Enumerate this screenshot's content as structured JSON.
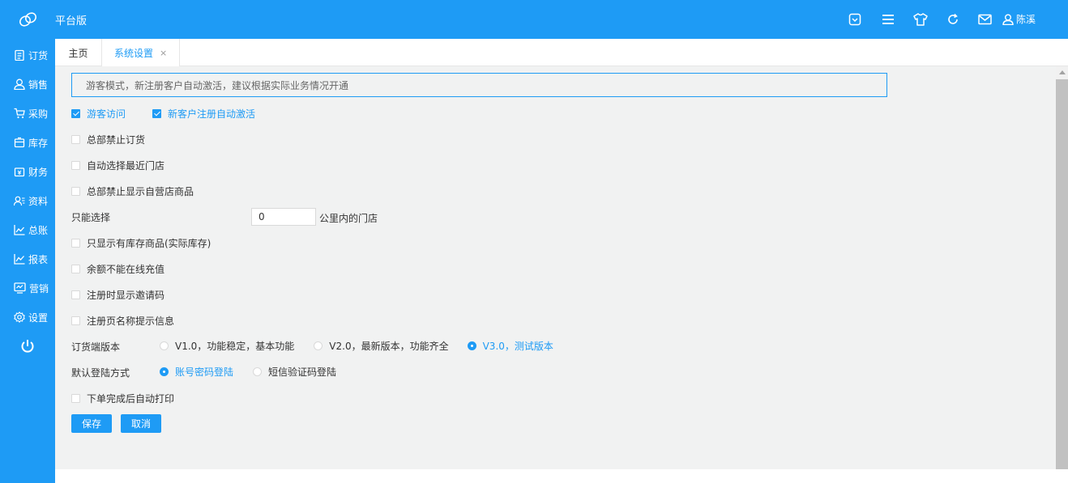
{
  "app": {
    "title": "平台版",
    "user_name": "陈溪"
  },
  "colors": {
    "primary": "#1e9bf5",
    "content_bg": "#f1f2f2"
  },
  "header_icons": [
    "message-icon",
    "menu-icon",
    "shirt-icon",
    "refresh-icon",
    "mail-icon",
    "user-icon"
  ],
  "sidebar": {
    "items": [
      {
        "label": "订货",
        "icon": "order-icon"
      },
      {
        "label": "销售",
        "icon": "sales-icon"
      },
      {
        "label": "采购",
        "icon": "cart-icon"
      },
      {
        "label": "库存",
        "icon": "inventory-icon"
      },
      {
        "label": "财务",
        "icon": "finance-icon"
      },
      {
        "label": "资料",
        "icon": "profile-icon"
      },
      {
        "label": "总账",
        "icon": "ledger-icon"
      },
      {
        "label": "报表",
        "icon": "report-icon"
      },
      {
        "label": "营销",
        "icon": "marketing-icon"
      },
      {
        "label": "设置",
        "icon": "settings-icon"
      }
    ]
  },
  "tabs": {
    "home": "主页",
    "settings": "系统设置",
    "close": "×"
  },
  "notice": "游客模式，新注册客户自动激活，建议根据实际业务情况开通",
  "options": {
    "guest_access": {
      "label": "游客访问",
      "checked": true
    },
    "auto_activate": {
      "label": "新客户注册自动激活",
      "checked": true
    },
    "hq_disable_order": {
      "label": "总部禁止订货",
      "checked": false
    },
    "auto_nearest_store": {
      "label": "自动选择最近门店",
      "checked": false
    },
    "hq_hide_own_products": {
      "label": "总部禁止显示自营店商品",
      "checked": false
    },
    "show_in_stock_only": {
      "label": "只显示有库存商品(实际库存)",
      "checked": false
    },
    "balance_no_online_recharge": {
      "label": "余额不能在线充值",
      "checked": false
    },
    "show_invite_code": {
      "label": "注册时显示邀请码",
      "checked": false
    },
    "register_name_hint": {
      "label": "注册页名称提示信息",
      "checked": false
    },
    "auto_print": {
      "label": "下单完成后自动打印",
      "checked": false
    }
  },
  "distance": {
    "label": "只能选择",
    "value": "0",
    "unit": "公里内的门店"
  },
  "client_version": {
    "label": "订货端版本",
    "options": [
      "V1.0，功能稳定，基本功能",
      "V2.0，最新版本，功能齐全",
      "V3.0，测试版本"
    ],
    "selected": 2
  },
  "login_method": {
    "label": "默认登陆方式",
    "options": [
      "账号密码登陆",
      "短信验证码登陆"
    ],
    "selected": 0
  },
  "buttons": {
    "save": "保存",
    "cancel": "取消"
  }
}
